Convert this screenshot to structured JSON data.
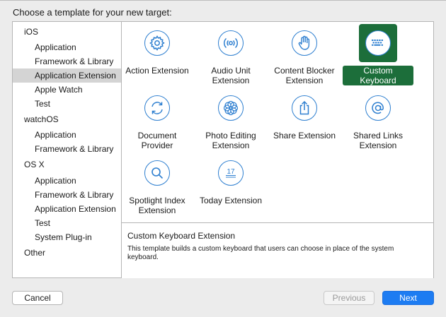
{
  "heading": "Choose a template for your new target:",
  "sidebar": {
    "items": [
      {
        "label": "iOS",
        "kind": "category",
        "selected": false
      },
      {
        "label": "Application",
        "kind": "item",
        "selected": false
      },
      {
        "label": "Framework & Library",
        "kind": "item",
        "selected": false
      },
      {
        "label": "Application Extension",
        "kind": "item",
        "selected": true
      },
      {
        "label": "Apple Watch",
        "kind": "item",
        "selected": false
      },
      {
        "label": "Test",
        "kind": "item",
        "selected": false
      },
      {
        "label": "watchOS",
        "kind": "category",
        "selected": false
      },
      {
        "label": "Application",
        "kind": "item",
        "selected": false
      },
      {
        "label": "Framework & Library",
        "kind": "item",
        "selected": false
      },
      {
        "label": "OS X",
        "kind": "category",
        "selected": false
      },
      {
        "label": "Application",
        "kind": "item",
        "selected": false
      },
      {
        "label": "Framework & Library",
        "kind": "item",
        "selected": false
      },
      {
        "label": "Application Extension",
        "kind": "item",
        "selected": false
      },
      {
        "label": "Test",
        "kind": "item",
        "selected": false
      },
      {
        "label": "System Plug-in",
        "kind": "item",
        "selected": false
      },
      {
        "label": "Other",
        "kind": "category",
        "selected": false
      }
    ]
  },
  "templates": [
    {
      "label": "Action Extension",
      "icon": "gear-icon",
      "selected": false
    },
    {
      "label": "Audio Unit Extension",
      "icon": "audio-waves-icon",
      "selected": false
    },
    {
      "label": "Content Blocker Extension",
      "icon": "hand-icon",
      "selected": false
    },
    {
      "label": "Custom Keyboard",
      "icon": "keyboard-icon",
      "selected": true
    },
    {
      "label": "Document Provider",
      "icon": "sync-arrows-icon",
      "selected": false
    },
    {
      "label": "Photo Editing Extension",
      "icon": "flower-icon",
      "selected": false
    },
    {
      "label": "Share Extension",
      "icon": "share-icon",
      "selected": false
    },
    {
      "label": "Shared Links Extension",
      "icon": "at-sign-icon",
      "selected": false
    },
    {
      "label": "Spotlight Index Extension",
      "icon": "magnifier-icon",
      "selected": false
    },
    {
      "label": "Today Extension",
      "icon": "calendar-icon",
      "selected": false
    }
  ],
  "calendar_day": "17",
  "description": {
    "title": "Custom Keyboard Extension",
    "body": "This template builds a custom keyboard that users can choose in place of the system keyboard."
  },
  "buttons": {
    "cancel": "Cancel",
    "previous": "Previous",
    "next": "Next"
  },
  "colors": {
    "accent": "#2e7fd0",
    "selection": "#1c6e3a",
    "next_button": "#1d7cf2"
  }
}
